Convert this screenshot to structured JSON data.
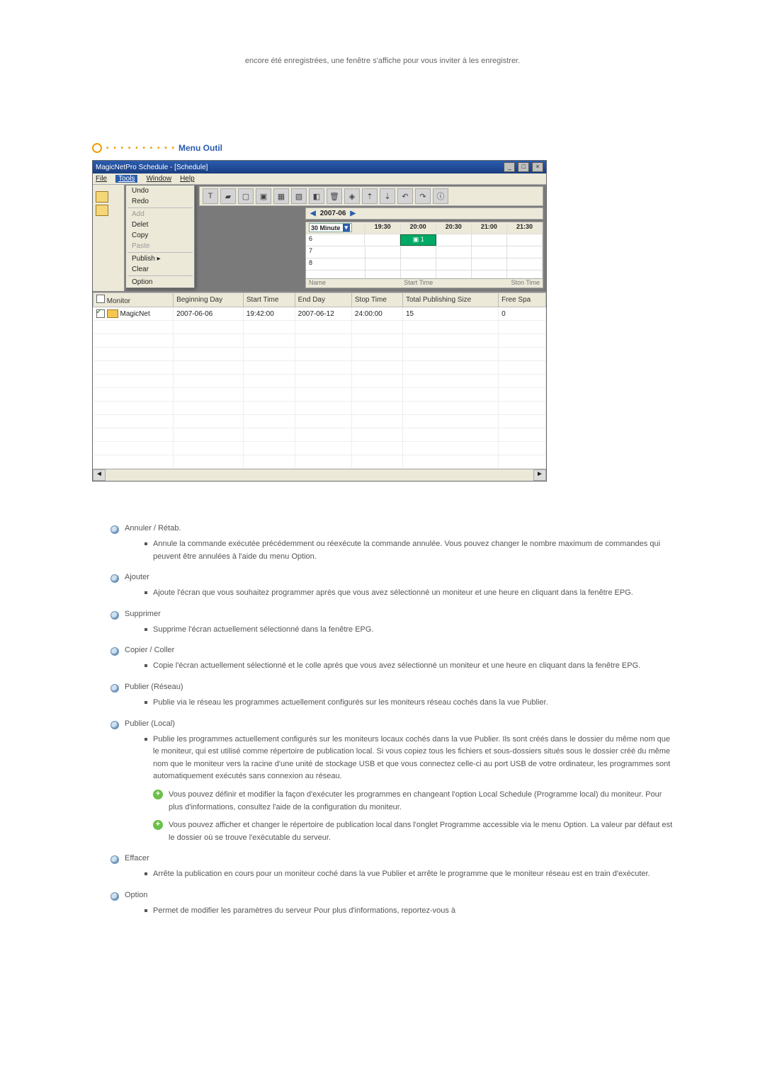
{
  "intro": "encore été enregistrées, une fenêtre s'affiche pour vous inviter à les enregistrer.",
  "section_title": "Menu Outil",
  "app": {
    "title": "MagicNetPro Schedule - [Schedule]",
    "menubar": [
      "File",
      "Tools",
      "Window",
      "Help"
    ],
    "dropdown": {
      "items": [
        "Undo",
        "Redo",
        "Add",
        "Delet",
        "Copy",
        "Paste",
        "Publish  ▸",
        "Clear",
        "Option"
      ],
      "disabled": [
        "Add",
        "Paste"
      ]
    },
    "toolbar_glyphs": [
      "T",
      "▰",
      "▢",
      "▣",
      "▦",
      "▧",
      "◧",
      "🗑",
      "◈",
      "⇡",
      "⇣",
      "↶",
      "↷",
      "ⓘ"
    ],
    "date_nav": {
      "prev": "◀",
      "label": "2007-06",
      "next": "▶"
    },
    "epg": {
      "combo": "30 Minute",
      "head": [
        "19:30",
        "20:00",
        "20:30",
        "21:00",
        "21:30"
      ],
      "rows_left": [
        "6",
        "7",
        "8",
        ""
      ],
      "block_label": "▣ 1"
    },
    "hscroll": {
      "left": "Name",
      "mid": "Start Time",
      "right": "Ston Time"
    },
    "table": {
      "headers": [
        "Monitor",
        "Beginning Day",
        "Start Time",
        "End Day",
        "Stop Time",
        "Total Publishing Size",
        "Free Spa"
      ],
      "row": {
        "monitor": "MagicNet",
        "begin": "2007-06-06",
        "start": "19:42:00",
        "end": "2007-06-12",
        "stop": "24:00:00",
        "size": "15",
        "free": "0"
      }
    }
  },
  "items": [
    {
      "title": "Annuler / Rétab.",
      "desc": [
        "Annule la commande exécutée précédemment ou réexécute la commande annulée. Vous pouvez changer le nombre maximum de commandes qui peuvent être annulées à l'aide du menu Option."
      ]
    },
    {
      "title": "Ajouter",
      "desc": [
        "Ajoute l'écran que vous souhaitez programmer après que vous avez sélectionné un moniteur et une heure en cliquant dans la fenêtre EPG."
      ]
    },
    {
      "title": "Supprimer",
      "desc": [
        "Supprime l'écran actuellement sélectionné dans la fenêtre EPG."
      ]
    },
    {
      "title": "Copier / Coller",
      "desc": [
        "Copie l'écran actuellement sélectionné et le colle après que vous avez sélectionné un moniteur et une heure en cliquant dans la fenêtre EPG."
      ]
    },
    {
      "title": "Publier (Réseau)",
      "desc": [
        "Publie via le réseau les programmes actuellement configurés sur les moniteurs réseau cochés dans la vue Publier."
      ]
    },
    {
      "title": "Publier (Local)",
      "desc": [
        "Publie les programmes actuellement configurés sur les moniteurs locaux cochés dans la vue Publier. Ils sont créés dans le dossier du même nom que le moniteur, qui est utilisé comme répertoire de publication local. Si vous copiez tous les fichiers et sous-dossiers situés sous le dossier créé du même nom que le moniteur vers la racine d'une unité de stockage USB et que vous connectez celle-ci au port USB de votre ordinateur, les programmes sont automatiquement exécutés sans connexion au réseau."
      ],
      "notes": [
        "Vous pouvez définir et modifier la façon d'exécuter les programmes en changeant l'option Local Schedule (Programme local) du moniteur. Pour plus d'informations, consultez l'aide de la configuration du moniteur.",
        "Vous pouvez afficher et changer le répertoire de publication local dans l'onglet Programme accessible via le menu Option. La valeur par défaut est le dossier où se trouve l'exécutable du serveur."
      ]
    },
    {
      "title": "Effacer",
      "desc": [
        "Arrête la publication en cours pour un moniteur coché dans la vue Publier et arrête le programme que le moniteur réseau est en train d'exécuter."
      ]
    },
    {
      "title": "Option",
      "desc": [
        "Permet de modifier les paramètres du serveur Pour plus d'informations, reportez-vous à"
      ]
    }
  ]
}
